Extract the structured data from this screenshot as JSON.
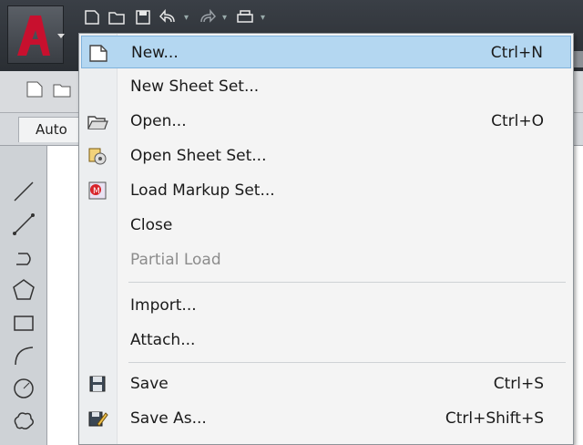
{
  "app": {
    "icon": "autocad-logo-icon",
    "accent": "#c8102e"
  },
  "quick_access": [
    {
      "icon": "new-file-icon"
    },
    {
      "icon": "open-folder-icon"
    },
    {
      "icon": "save-icon"
    },
    {
      "icon": "undo-icon"
    },
    {
      "icon": "redo-icon"
    },
    {
      "icon": "plot-icon"
    }
  ],
  "panel": {
    "tab_label": "Auto"
  },
  "menu": {
    "items": [
      {
        "label": "New...",
        "shortcut": "Ctrl+N",
        "icon": "new-file-icon",
        "highlighted": true
      },
      {
        "label": "New Sheet Set...",
        "shortcut": "",
        "icon": ""
      },
      {
        "label": "Open...",
        "shortcut": "Ctrl+O",
        "icon": "open-folder-icon"
      },
      {
        "label": "Open Sheet Set...",
        "shortcut": "",
        "icon": "open-sheet-set-icon"
      },
      {
        "label": "Load Markup Set...",
        "shortcut": "",
        "icon": "markup-set-icon"
      },
      {
        "label": "Close",
        "shortcut": "",
        "icon": ""
      },
      {
        "label": "Partial Load",
        "shortcut": "",
        "icon": "",
        "disabled": true
      },
      {
        "label": "Import...",
        "shortcut": "",
        "icon": ""
      },
      {
        "label": "Attach...",
        "shortcut": "",
        "icon": ""
      },
      {
        "label": "Save",
        "shortcut": "Ctrl+S",
        "icon": "save-icon"
      },
      {
        "label": "Save As...",
        "shortcut": "Ctrl+Shift+S",
        "icon": "save-as-icon"
      }
    ]
  },
  "colors": {
    "highlight": "#b4d7f1",
    "disabled_text": "#8c8c8c"
  }
}
